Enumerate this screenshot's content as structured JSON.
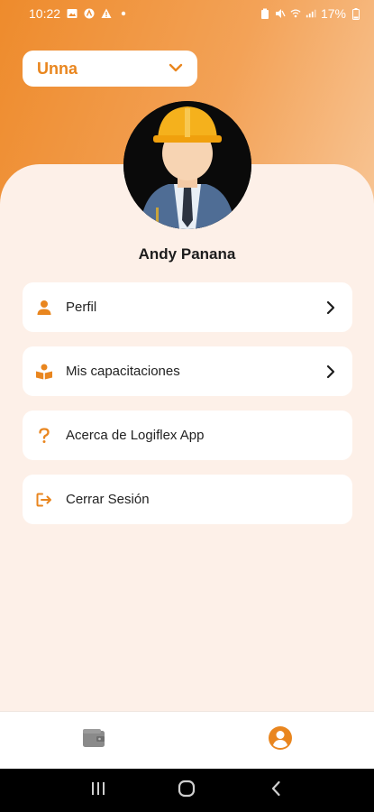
{
  "status_bar": {
    "time": "10:22",
    "battery": "17%",
    "left_icons": [
      "gallery-icon",
      "app-a-icon",
      "alert-icon",
      "dot-icon"
    ],
    "right_icons": [
      "battery-saver-icon",
      "mute-icon",
      "wifi-icon",
      "signal-icon"
    ]
  },
  "company_selector": {
    "selected": "Unna",
    "accent": "#e9861f"
  },
  "profile": {
    "name": "Andy Panana",
    "avatar_icon": "worker-avatar-icon"
  },
  "menu": {
    "items": [
      {
        "label": "Perfil",
        "icon": "person-icon",
        "has_chevron": true
      },
      {
        "label": "Mis capacitaciones",
        "icon": "reading-icon",
        "has_chevron": true
      },
      {
        "label": "Acerca de Logiflex App",
        "icon": "question-icon",
        "has_chevron": false
      },
      {
        "label": "Cerrar Sesión",
        "icon": "logout-icon",
        "has_chevron": false
      }
    ]
  },
  "bottom_nav": {
    "tabs": [
      {
        "icon": "wallet-icon",
        "active": false
      },
      {
        "icon": "account-circle-icon",
        "active": true
      }
    ],
    "active_color": "#e9861f",
    "inactive_color": "#8a8a8a"
  },
  "system_nav": {
    "buttons": [
      "recents-icon",
      "home-icon",
      "back-icon"
    ]
  },
  "colors": {
    "brand": "#ee8b2c",
    "background": "#fdf0e8"
  }
}
